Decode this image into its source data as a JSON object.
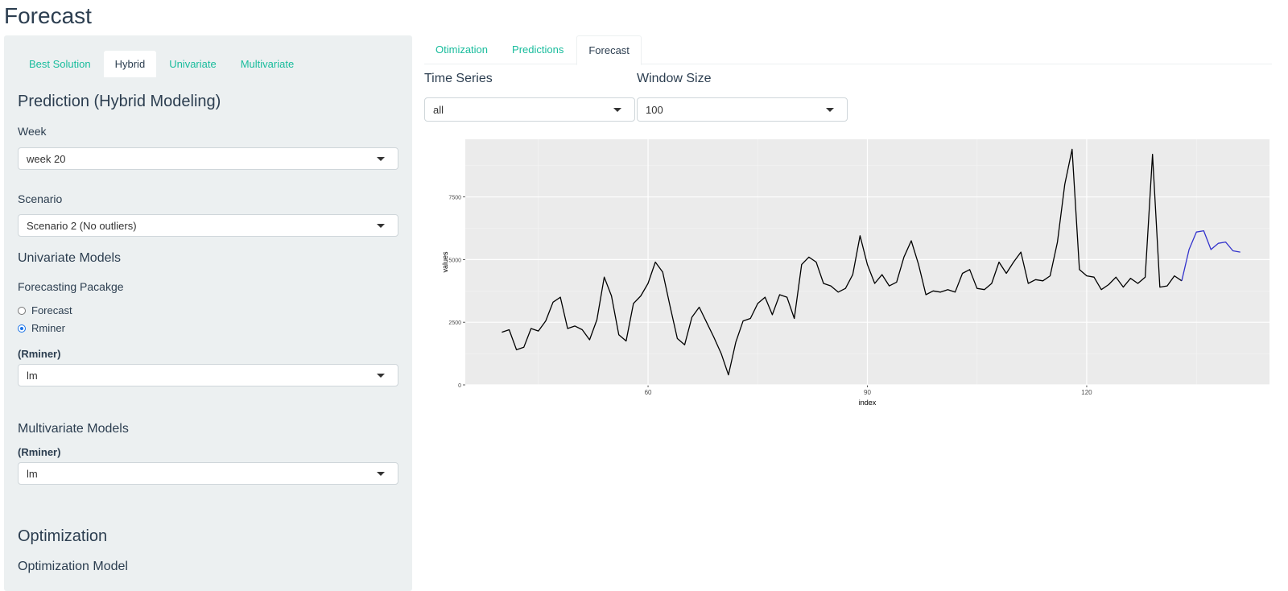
{
  "page_title": "Forecast",
  "sidebar": {
    "tabs": [
      {
        "label": "Best Solution",
        "active": false
      },
      {
        "label": "Hybrid",
        "active": true
      },
      {
        "label": "Univariate",
        "active": false
      },
      {
        "label": "Multivariate",
        "active": false
      }
    ],
    "section_title": "Prediction (Hybrid Modeling)",
    "week": {
      "label": "Week",
      "value": "week 20"
    },
    "scenario": {
      "label": "Scenario",
      "value": "Scenario 2 (No outliers)"
    },
    "univariate_title": "Univariate Models",
    "forecasting_package": {
      "label": "Forecasting Pacakge",
      "options": [
        {
          "label": "Forecast",
          "checked": false
        },
        {
          "label": "Rminer",
          "checked": true
        }
      ]
    },
    "univariate_rminer": {
      "label": "(Rminer)",
      "value": "lm"
    },
    "multivariate_title": "Multivariate Models",
    "multivariate_rminer": {
      "label": "(Rminer)",
      "value": "lm"
    },
    "optimization_title": "Optimization",
    "optimization_model_label": "Optimization Model"
  },
  "main": {
    "tabs": [
      {
        "label": "Otimization",
        "active": false
      },
      {
        "label": "Predictions",
        "active": false
      },
      {
        "label": "Forecast",
        "active": true
      }
    ],
    "time_series": {
      "label": "Time Series",
      "value": "all"
    },
    "window_size": {
      "label": "Window Size",
      "value": "100"
    }
  },
  "colors": {
    "accent": "#18bc9c",
    "sidebar_bg": "#ecf0f1",
    "panel_bg": "#ebebeb",
    "series_actual": "#000000",
    "series_forecast": "#3333cc"
  },
  "chart_data": {
    "type": "line",
    "xlabel": "index",
    "ylabel": "values",
    "xticks": [
      60,
      90,
      120
    ],
    "yticks": [
      0,
      2500,
      5000,
      7500
    ],
    "xlim": [
      35,
      145
    ],
    "ylim": [
      0,
      9800
    ],
    "series": [
      {
        "x": [
          40,
          41,
          42,
          43,
          44,
          45,
          46,
          47,
          48,
          49,
          50,
          51,
          52,
          53,
          54,
          55,
          56,
          57,
          58,
          59,
          60,
          61,
          62,
          63,
          64,
          65,
          66,
          67,
          68,
          69,
          70,
          71,
          72,
          73,
          74,
          75,
          76,
          77,
          78,
          79,
          80,
          81,
          82,
          83,
          84,
          85,
          86,
          87,
          88,
          89,
          90,
          91,
          92,
          93,
          94,
          95,
          96,
          97,
          98,
          99,
          100,
          101,
          102,
          103,
          104,
          105,
          106,
          107,
          108,
          109,
          110,
          111,
          112,
          113,
          114,
          115,
          116,
          117,
          118,
          119,
          120,
          121,
          122,
          123,
          124,
          125,
          126,
          127,
          128,
          129,
          130,
          131,
          132,
          133
        ],
        "values": [
          2100,
          2200,
          1400,
          1500,
          2250,
          2150,
          2550,
          3300,
          3500,
          2250,
          2350,
          2200,
          1800,
          2600,
          4300,
          3550,
          2000,
          1750,
          3250,
          3550,
          4050,
          4900,
          4500,
          3150,
          1850,
          1600,
          2700,
          3100,
          2500,
          1900,
          1250,
          400,
          1700,
          2550,
          2650,
          3250,
          3500,
          2800,
          3600,
          3500,
          2650,
          4800,
          5100,
          4900,
          4050,
          3950,
          3700,
          3850,
          4400,
          5950,
          4800,
          4050,
          4400,
          3950,
          4100,
          5100,
          5750,
          4800,
          3600,
          3750,
          3700,
          3800,
          3700,
          4450,
          4600,
          3850,
          3800,
          4050,
          4900,
          4450,
          4900,
          5300,
          4050,
          4200,
          4150,
          4350,
          5700,
          8000,
          9400,
          4600,
          4350,
          4300,
          3800,
          4000,
          4300,
          3900,
          4250,
          4050,
          4300,
          9200,
          3900,
          3950,
          4350,
          4150
        ]
      },
      {
        "x": [
          133,
          134,
          135,
          136,
          137,
          138,
          139,
          140,
          141
        ],
        "values": [
          4150,
          5400,
          6100,
          6150,
          5400,
          5650,
          5700,
          5350,
          5300
        ]
      }
    ]
  }
}
